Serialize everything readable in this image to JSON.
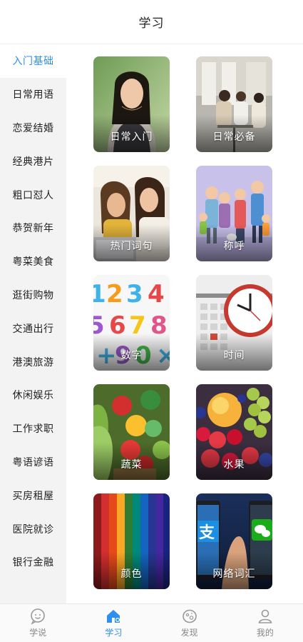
{
  "header": {
    "title": "学习"
  },
  "sidebar": {
    "items": [
      {
        "label": "入门基础",
        "active": true
      },
      {
        "label": "日常用语"
      },
      {
        "label": "恋爱结婚"
      },
      {
        "label": "经典港片"
      },
      {
        "label": "粗口怼人"
      },
      {
        "label": "恭贺新年"
      },
      {
        "label": "粤菜美食"
      },
      {
        "label": "逛街购物"
      },
      {
        "label": "交通出行"
      },
      {
        "label": "港澳旅游"
      },
      {
        "label": "休闲娱乐"
      },
      {
        "label": "工作求职"
      },
      {
        "label": "粤语谚语"
      },
      {
        "label": "买房租屋"
      },
      {
        "label": "医院就诊"
      },
      {
        "label": "银行金融"
      }
    ]
  },
  "cards": [
    {
      "label": "日常入门",
      "art": "woman-portrait"
    },
    {
      "label": "日常必备",
      "art": "cafe-friends"
    },
    {
      "label": "热门词句",
      "art": "women-whispering"
    },
    {
      "label": "称呼",
      "art": "family-cartoon"
    },
    {
      "label": "数字",
      "art": "colorful-numbers"
    },
    {
      "label": "时间",
      "art": "clock-calendar"
    },
    {
      "label": "蔬菜",
      "art": "vegetables"
    },
    {
      "label": "水果",
      "art": "fruits"
    },
    {
      "label": "颜色",
      "art": "color-stripes"
    },
    {
      "label": "网络词汇",
      "art": "phones-apps"
    }
  ],
  "tabbar": {
    "items": [
      {
        "label": "学说",
        "icon": "chat-smile-icon"
      },
      {
        "label": "学习",
        "icon": "home-icon",
        "active": true
      },
      {
        "label": "发现",
        "icon": "discover-icon"
      },
      {
        "label": "我的",
        "icon": "user-icon"
      }
    ]
  },
  "colors": {
    "accent": "#2f8ff0",
    "sidebar_bg": "#f3f3f3",
    "text": "#222222"
  }
}
